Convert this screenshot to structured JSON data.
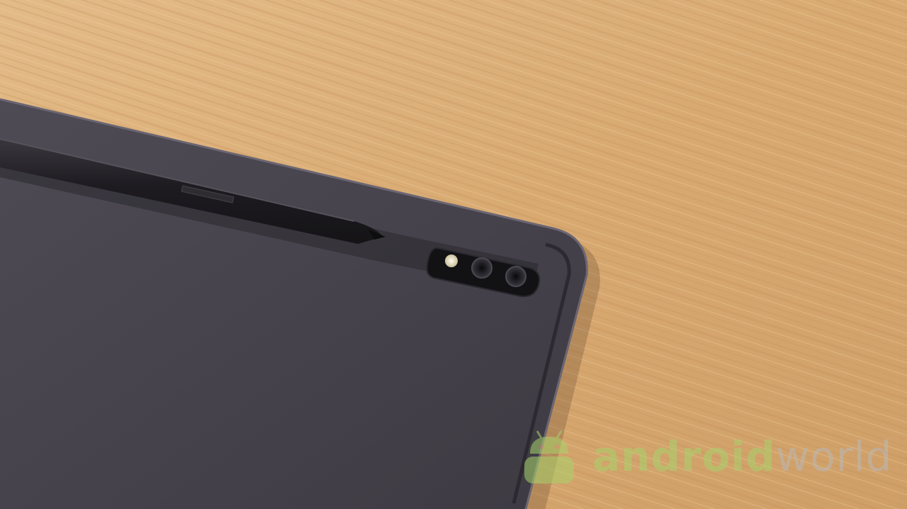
{
  "photo": {
    "subject_icons": [
      "tablet-icon",
      "stylus-icon",
      "camera-module-icon",
      "flash-icon",
      "camera-lens-icon"
    ],
    "colors": {
      "table_wood": "#d9ad78",
      "tablet_body": "#4a4650",
      "stylus": "#1f1d22",
      "camera_module": "#121114",
      "flash": "#f1ead2"
    }
  },
  "watermark": {
    "part_android": "android",
    "part_world": "world",
    "icon": "android-robot-icon",
    "colors": {
      "android": "#a8d36b",
      "world": "#b9b9b9"
    }
  }
}
